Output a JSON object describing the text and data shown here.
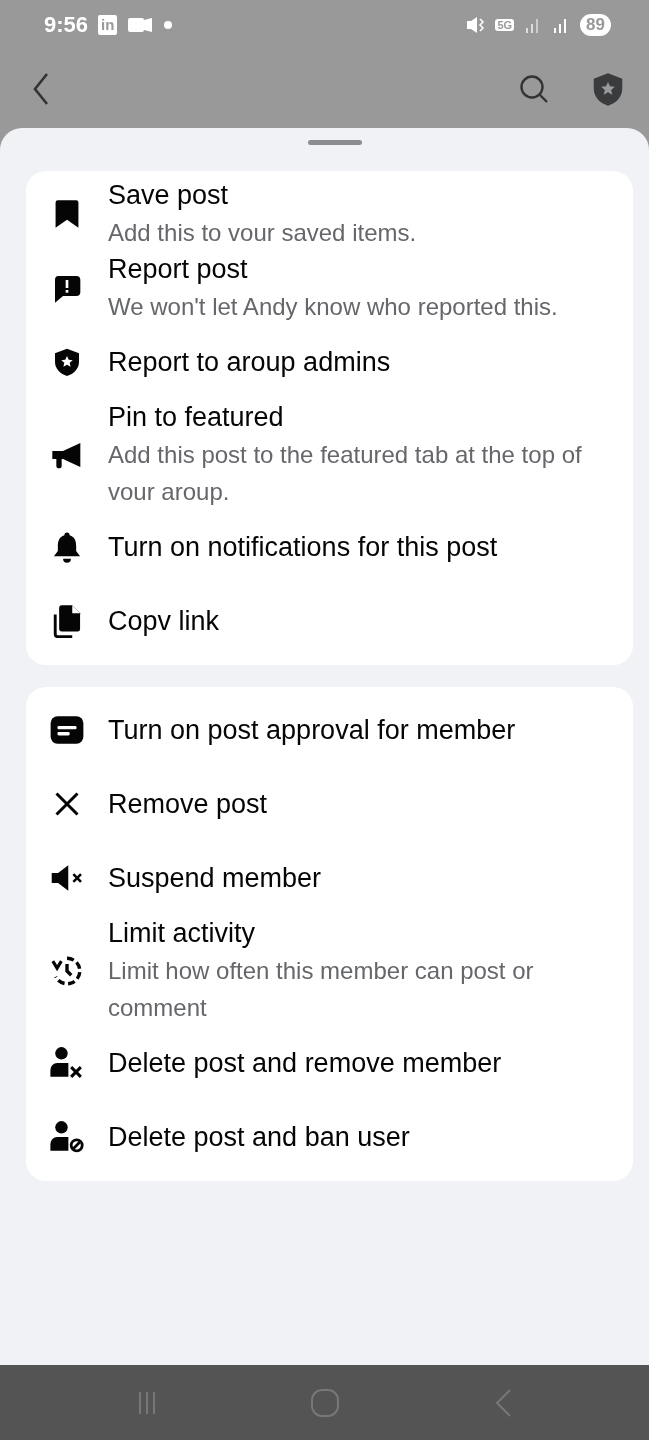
{
  "status_bar": {
    "time": "9:56",
    "app_badge": "in",
    "network": "5G",
    "battery": "89"
  },
  "sections": [
    {
      "items": [
        {
          "title": "Save post",
          "subtitle": "Add this to vour saved items."
        },
        {
          "title": "Report post",
          "subtitle": "We won't let Andy know who reported this."
        },
        {
          "title": "Report to aroup admins"
        },
        {
          "title": "Pin to featured",
          "subtitle": "Add this post to the featured tab at the top of vour aroup."
        },
        {
          "title": "Turn on notifications for this post"
        },
        {
          "title": "Copv link"
        }
      ]
    },
    {
      "items": [
        {
          "title": "Turn on post approval for member"
        },
        {
          "title": "Remove post"
        },
        {
          "title": "Suspend member"
        },
        {
          "title": "Limit activity",
          "subtitle": "Limit how often this member can post or comment"
        },
        {
          "title": "Delete post and remove member"
        },
        {
          "title": "Delete post and ban user"
        }
      ]
    }
  ]
}
